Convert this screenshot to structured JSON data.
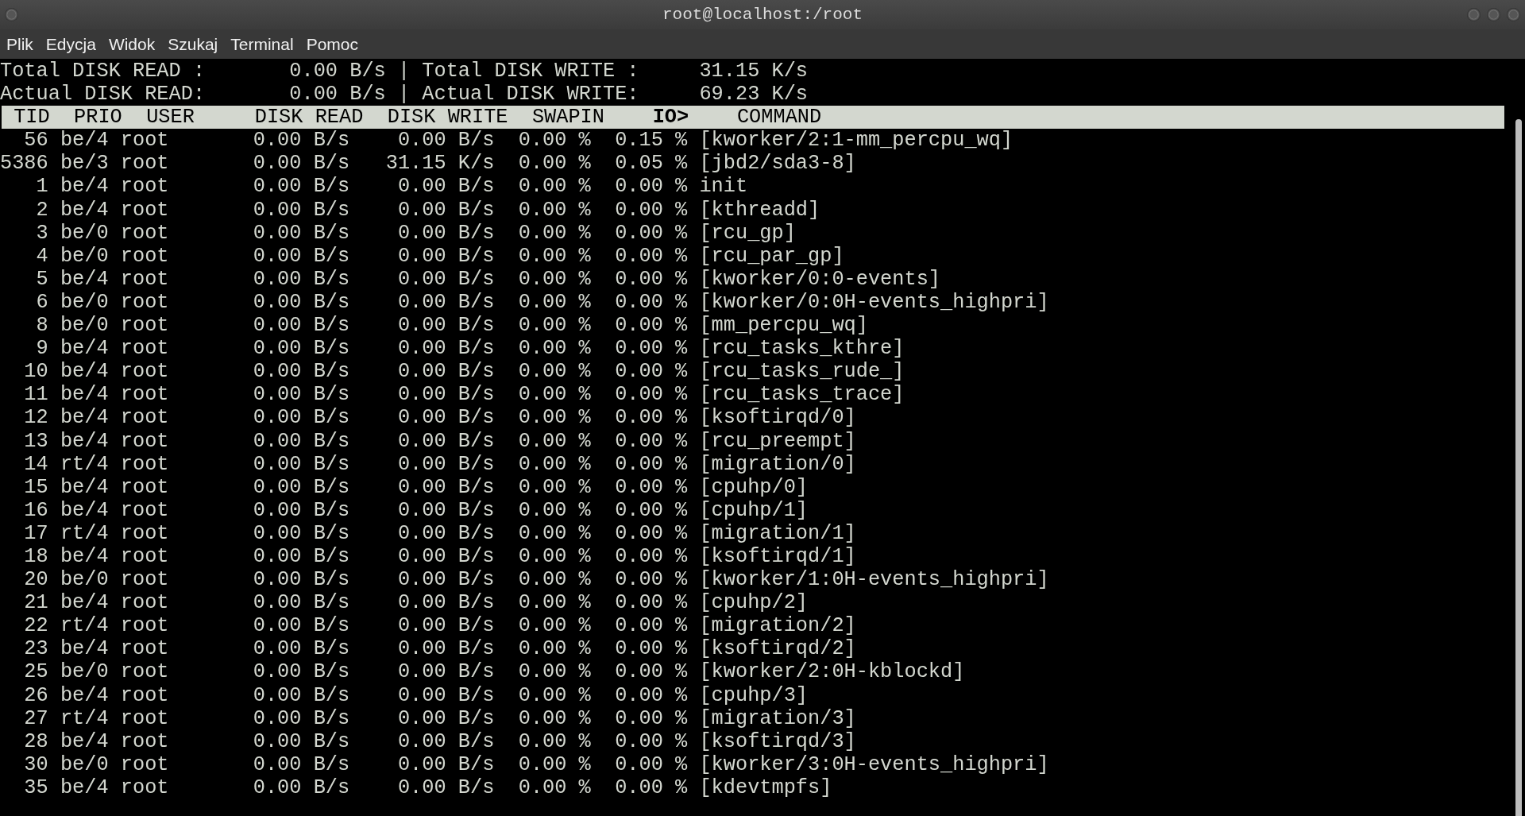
{
  "window": {
    "title": "root@localhost:/root"
  },
  "menu": [
    "Plik",
    "Edycja",
    "Widok",
    "Szukaj",
    "Terminal",
    "Pomoc"
  ],
  "summary": [
    {
      "read_label": "Total DISK READ :",
      "read_value": "0.00 B/s",
      "separator": "|",
      "write_label": "Total DISK WRITE :",
      "write_value": "31.15 K/s"
    },
    {
      "read_label": "Actual DISK READ:",
      "read_value": "0.00 B/s",
      "separator": "|",
      "write_label": "Actual DISK WRITE:",
      "write_value": "69.23 K/s"
    }
  ],
  "columns": [
    {
      "label": "TID",
      "sorted": false
    },
    {
      "label": "PRIO",
      "sorted": false
    },
    {
      "label": "USER",
      "sorted": false
    },
    {
      "label": "DISK READ",
      "sorted": false
    },
    {
      "label": "DISK WRITE",
      "sorted": false
    },
    {
      "label": "SWAPIN",
      "sorted": false
    },
    {
      "label": "IO>",
      "sorted": true
    },
    {
      "label": "COMMAND",
      "sorted": false
    }
  ],
  "rows": [
    [
      "56",
      "be/4",
      "root",
      "0.00 B/s",
      "0.00 B/s",
      "0.00 %",
      "0.15 %",
      "[kworker/2:1-mm_percpu_wq]"
    ],
    [
      "5386",
      "be/3",
      "root",
      "0.00 B/s",
      "31.15 K/s",
      "0.00 %",
      "0.05 %",
      "[jbd2/sda3-8]"
    ],
    [
      "1",
      "be/4",
      "root",
      "0.00 B/s",
      "0.00 B/s",
      "0.00 %",
      "0.00 %",
      "init"
    ],
    [
      "2",
      "be/4",
      "root",
      "0.00 B/s",
      "0.00 B/s",
      "0.00 %",
      "0.00 %",
      "[kthreadd]"
    ],
    [
      "3",
      "be/0",
      "root",
      "0.00 B/s",
      "0.00 B/s",
      "0.00 %",
      "0.00 %",
      "[rcu_gp]"
    ],
    [
      "4",
      "be/0",
      "root",
      "0.00 B/s",
      "0.00 B/s",
      "0.00 %",
      "0.00 %",
      "[rcu_par_gp]"
    ],
    [
      "5",
      "be/4",
      "root",
      "0.00 B/s",
      "0.00 B/s",
      "0.00 %",
      "0.00 %",
      "[kworker/0:0-events]"
    ],
    [
      "6",
      "be/0",
      "root",
      "0.00 B/s",
      "0.00 B/s",
      "0.00 %",
      "0.00 %",
      "[kworker/0:0H-events_highpri]"
    ],
    [
      "8",
      "be/0",
      "root",
      "0.00 B/s",
      "0.00 B/s",
      "0.00 %",
      "0.00 %",
      "[mm_percpu_wq]"
    ],
    [
      "9",
      "be/4",
      "root",
      "0.00 B/s",
      "0.00 B/s",
      "0.00 %",
      "0.00 %",
      "[rcu_tasks_kthre]"
    ],
    [
      "10",
      "be/4",
      "root",
      "0.00 B/s",
      "0.00 B/s",
      "0.00 %",
      "0.00 %",
      "[rcu_tasks_rude_]"
    ],
    [
      "11",
      "be/4",
      "root",
      "0.00 B/s",
      "0.00 B/s",
      "0.00 %",
      "0.00 %",
      "[rcu_tasks_trace]"
    ],
    [
      "12",
      "be/4",
      "root",
      "0.00 B/s",
      "0.00 B/s",
      "0.00 %",
      "0.00 %",
      "[ksoftirqd/0]"
    ],
    [
      "13",
      "be/4",
      "root",
      "0.00 B/s",
      "0.00 B/s",
      "0.00 %",
      "0.00 %",
      "[rcu_preempt]"
    ],
    [
      "14",
      "rt/4",
      "root",
      "0.00 B/s",
      "0.00 B/s",
      "0.00 %",
      "0.00 %",
      "[migration/0]"
    ],
    [
      "15",
      "be/4",
      "root",
      "0.00 B/s",
      "0.00 B/s",
      "0.00 %",
      "0.00 %",
      "[cpuhp/0]"
    ],
    [
      "16",
      "be/4",
      "root",
      "0.00 B/s",
      "0.00 B/s",
      "0.00 %",
      "0.00 %",
      "[cpuhp/1]"
    ],
    [
      "17",
      "rt/4",
      "root",
      "0.00 B/s",
      "0.00 B/s",
      "0.00 %",
      "0.00 %",
      "[migration/1]"
    ],
    [
      "18",
      "be/4",
      "root",
      "0.00 B/s",
      "0.00 B/s",
      "0.00 %",
      "0.00 %",
      "[ksoftirqd/1]"
    ],
    [
      "20",
      "be/0",
      "root",
      "0.00 B/s",
      "0.00 B/s",
      "0.00 %",
      "0.00 %",
      "[kworker/1:0H-events_highpri]"
    ],
    [
      "21",
      "be/4",
      "root",
      "0.00 B/s",
      "0.00 B/s",
      "0.00 %",
      "0.00 %",
      "[cpuhp/2]"
    ],
    [
      "22",
      "rt/4",
      "root",
      "0.00 B/s",
      "0.00 B/s",
      "0.00 %",
      "0.00 %",
      "[migration/2]"
    ],
    [
      "23",
      "be/4",
      "root",
      "0.00 B/s",
      "0.00 B/s",
      "0.00 %",
      "0.00 %",
      "[ksoftirqd/2]"
    ],
    [
      "25",
      "be/0",
      "root",
      "0.00 B/s",
      "0.00 B/s",
      "0.00 %",
      "0.00 %",
      "[kworker/2:0H-kblockd]"
    ],
    [
      "26",
      "be/4",
      "root",
      "0.00 B/s",
      "0.00 B/s",
      "0.00 %",
      "0.00 %",
      "[cpuhp/3]"
    ],
    [
      "27",
      "rt/4",
      "root",
      "0.00 B/s",
      "0.00 B/s",
      "0.00 %",
      "0.00 %",
      "[migration/3]"
    ],
    [
      "28",
      "be/4",
      "root",
      "0.00 B/s",
      "0.00 B/s",
      "0.00 %",
      "0.00 %",
      "[ksoftirqd/3]"
    ],
    [
      "30",
      "be/0",
      "root",
      "0.00 B/s",
      "0.00 B/s",
      "0.00 %",
      "0.00 %",
      "[kworker/3:0H-events_highpri]"
    ],
    [
      "35",
      "be/4",
      "root",
      "0.00 B/s",
      "0.00 B/s",
      "0.00 %",
      "0.00 %",
      "[kdevtmpfs]"
    ]
  ]
}
